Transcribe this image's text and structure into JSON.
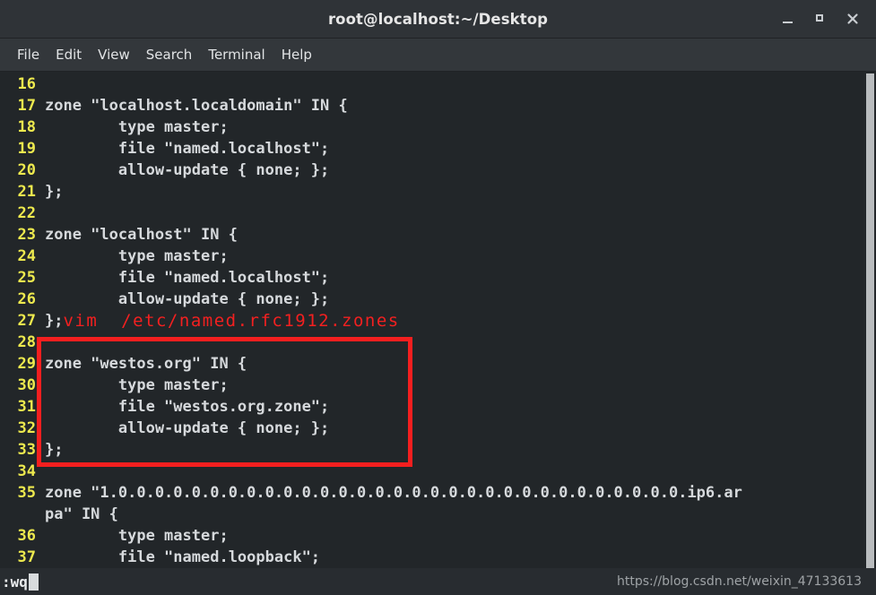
{
  "window": {
    "title": "root@localhost:~/Desktop",
    "controls": {
      "minimize": "minimize-icon",
      "maximize": "maximize-icon",
      "close": "close-icon"
    }
  },
  "menubar": {
    "items": [
      {
        "label": "File"
      },
      {
        "label": "Edit"
      },
      {
        "label": "View"
      },
      {
        "label": "Search"
      },
      {
        "label": "Terminal"
      },
      {
        "label": "Help"
      }
    ]
  },
  "editor": {
    "lines": [
      {
        "number": "16",
        "text": ""
      },
      {
        "number": "17",
        "text": "zone \"localhost.localdomain\" IN {"
      },
      {
        "number": "18",
        "text": "        type master;"
      },
      {
        "number": "19",
        "text": "        file \"named.localhost\";"
      },
      {
        "number": "20",
        "text": "        allow-update { none; };"
      },
      {
        "number": "21",
        "text": "};"
      },
      {
        "number": "22",
        "text": ""
      },
      {
        "number": "23",
        "text": "zone \"localhost\" IN {"
      },
      {
        "number": "24",
        "text": "        type master;"
      },
      {
        "number": "25",
        "text": "        file \"named.localhost\";"
      },
      {
        "number": "26",
        "text": "        allow-update { none; };"
      },
      {
        "number": "27",
        "text": "};",
        "annotation": "vim  /etc/named.rfc1912.zones"
      },
      {
        "number": "28",
        "text": ""
      },
      {
        "number": "29",
        "text": "zone \"westos.org\" IN {"
      },
      {
        "number": "30",
        "text": "        type master;"
      },
      {
        "number": "31",
        "text": "        file \"westos.org.zone\";"
      },
      {
        "number": "32",
        "text": "        allow-update { none; };"
      },
      {
        "number": "33",
        "text": "};"
      },
      {
        "number": "34",
        "text": ""
      },
      {
        "number": "35",
        "text": "zone \"1.0.0.0.0.0.0.0.0.0.0.0.0.0.0.0.0.0.0.0.0.0.0.0.0.0.0.0.0.0.0.0.ip6.ar",
        "wrapped": "pa\" IN {"
      },
      {
        "number": "36",
        "text": "        type master;"
      },
      {
        "number": "37",
        "text": "        file \"named.loopback\";"
      }
    ],
    "colors": {
      "line_number": "#ede94e",
      "text": "#d6d9dc",
      "background": "#222629",
      "annotation": "#f32020",
      "highlight_box": "#f51f1f"
    }
  },
  "statusbar": {
    "command": ":wq",
    "watermark": "https://blog.csdn.net/weixin_47133613"
  }
}
